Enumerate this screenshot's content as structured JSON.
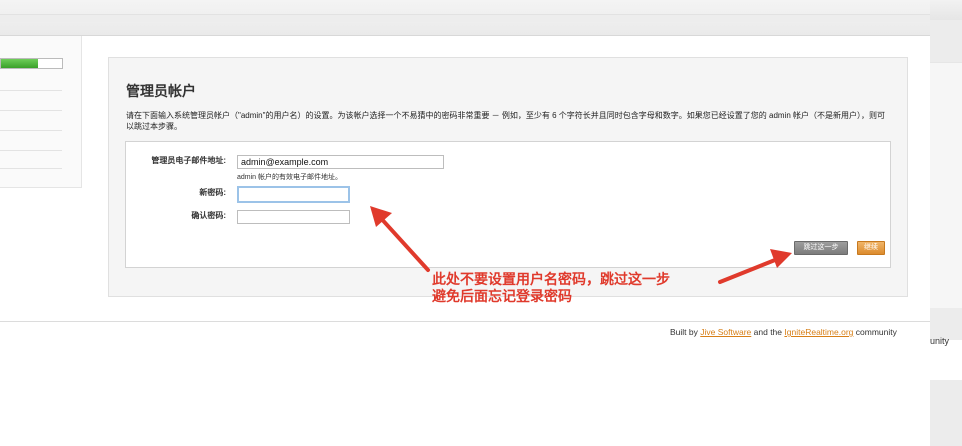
{
  "header": {},
  "sidebar": {
    "progress": 0.6
  },
  "main": {
    "title": "管理员帐户",
    "description": "请在下面输入系统管理员帐户（\"admin\"的用户名）的设置。为该帐户选择一个不易猜中的密码非常重要 － 例如，至少有 6 个字符长并且同时包含字母和数字。如果您已经设置了您的 admin 帐户（不是新用户），则可以跳过本步骤。",
    "form": {
      "email_label": "管理员电子邮件地址:",
      "email_value": "admin@example.com",
      "email_hint": "admin 帐户的有效电子邮件地址。",
      "new_password_label": "新密码:",
      "new_password_value": "",
      "confirm_password_label": "确认密码:",
      "confirm_password_value": ""
    },
    "buttons": {
      "skip_label": "跳过这一步",
      "continue_label": "继续"
    }
  },
  "annotation": {
    "line1": "此处不要设置用户名密码，跳过这一步",
    "line2": "避免后面忘记登录密码",
    "color": "#e03a2c"
  },
  "footer": {
    "built_by": "Built by",
    "jive_link": "Jive Software",
    "and_the": "and the",
    "ignite_link": "IgniteRealtime.org",
    "community": "community",
    "edge_fragment": "unity"
  },
  "colors": {
    "accent_orange": "#d77f17",
    "progress_green": "#3aa12a",
    "arrow_red": "#e03a2c"
  }
}
